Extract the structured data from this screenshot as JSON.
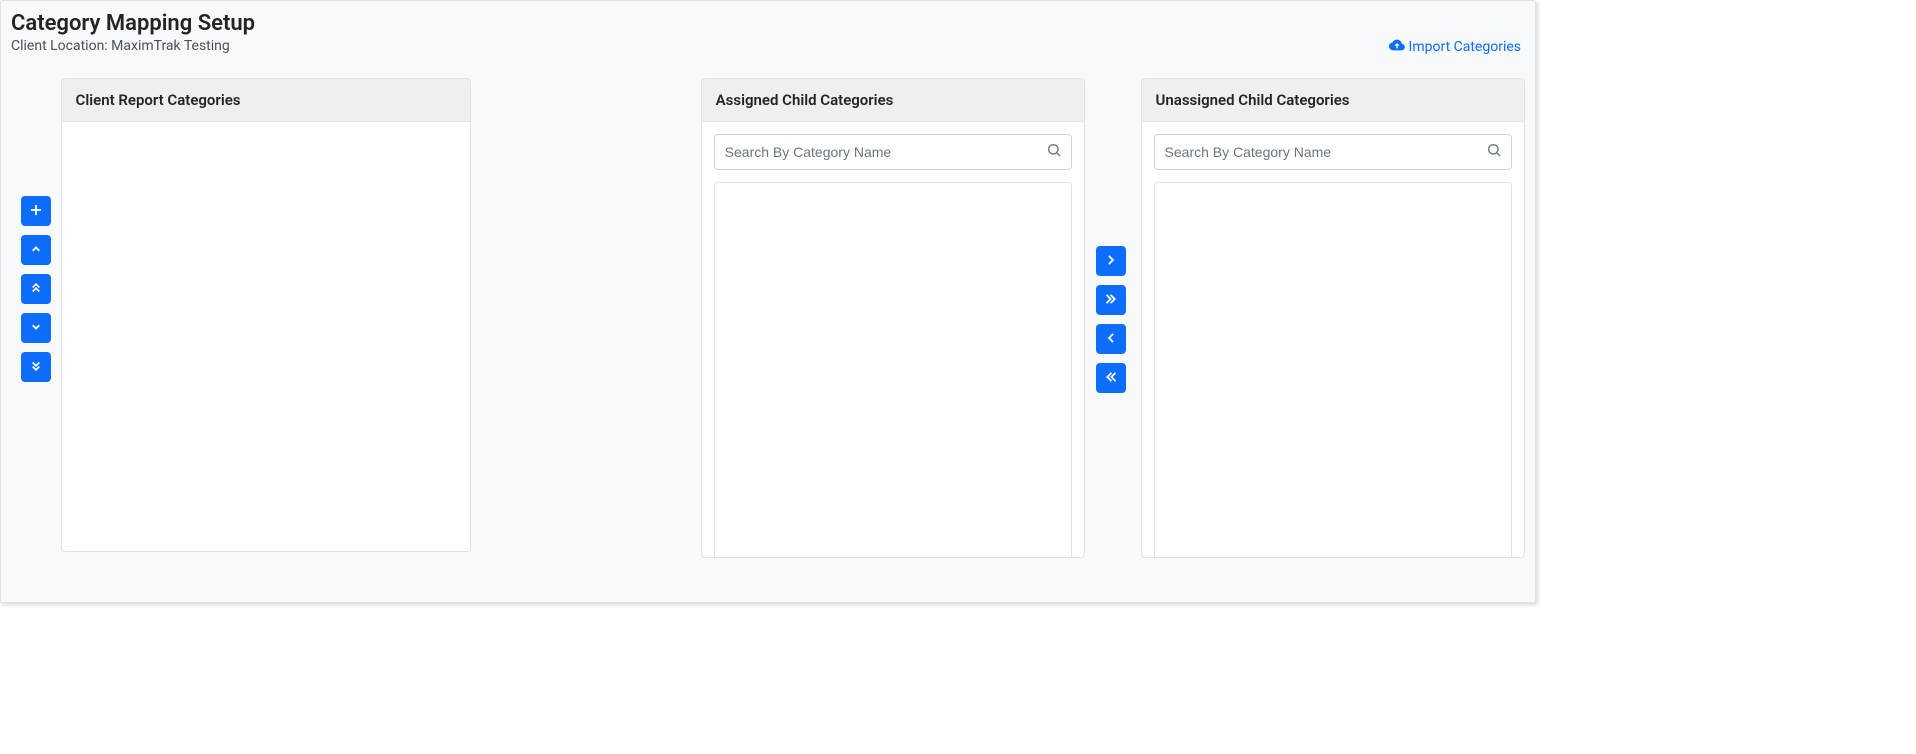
{
  "header": {
    "title": "Category Mapping Setup",
    "subtitle": "Client Location: MaximTrak Testing",
    "import_label": "Import Categories"
  },
  "panels": {
    "client": {
      "title": "Client Report Categories"
    },
    "assigned": {
      "title": "Assigned Child Categories",
      "search_placeholder": "Search By Category Name"
    },
    "unassigned": {
      "title": "Unassigned Child Categories",
      "search_placeholder": "Search By Category Name"
    }
  }
}
